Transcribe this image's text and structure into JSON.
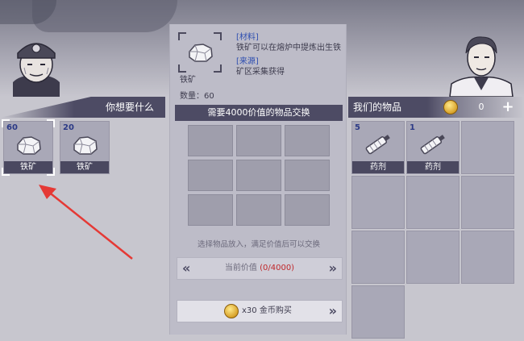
{
  "left": {
    "banner": "你想要什么",
    "items": [
      {
        "count": "60",
        "name": "铁矿",
        "selected": true
      },
      {
        "count": "20",
        "name": "铁矿",
        "selected": false
      }
    ]
  },
  "detail": {
    "name": "铁矿",
    "quantity": "数量：60",
    "material_tag": "[材料]",
    "material_desc": "铁矿可以在熔炉中提炼出生铁",
    "source_tag": "[来源]",
    "source_desc": "矿区采集获得"
  },
  "exchange": {
    "header": "需要4000价值的物品交换",
    "hint": "选择物品放入，满足价值后可以交换",
    "value_label": "当前价值",
    "value": "(0/4000)",
    "buy_label": "x30 金币购买"
  },
  "right": {
    "banner": "我们的物品",
    "coins": "0",
    "plus": "+",
    "items": [
      {
        "count": "5",
        "name": "药剂"
      },
      {
        "count": "1",
        "name": "药剂"
      }
    ]
  },
  "colors": {
    "banner": "#4d4b64",
    "accent_red": "#c0282b",
    "count_blue": "#2c3a86",
    "tag_blue": "#2f4fb0",
    "arrow_red": "#e53935"
  },
  "icons": {
    "iron_ore": "iron-ore-icon",
    "potion": "potion-syringe-icon",
    "coin": "gold-coin-icon"
  }
}
